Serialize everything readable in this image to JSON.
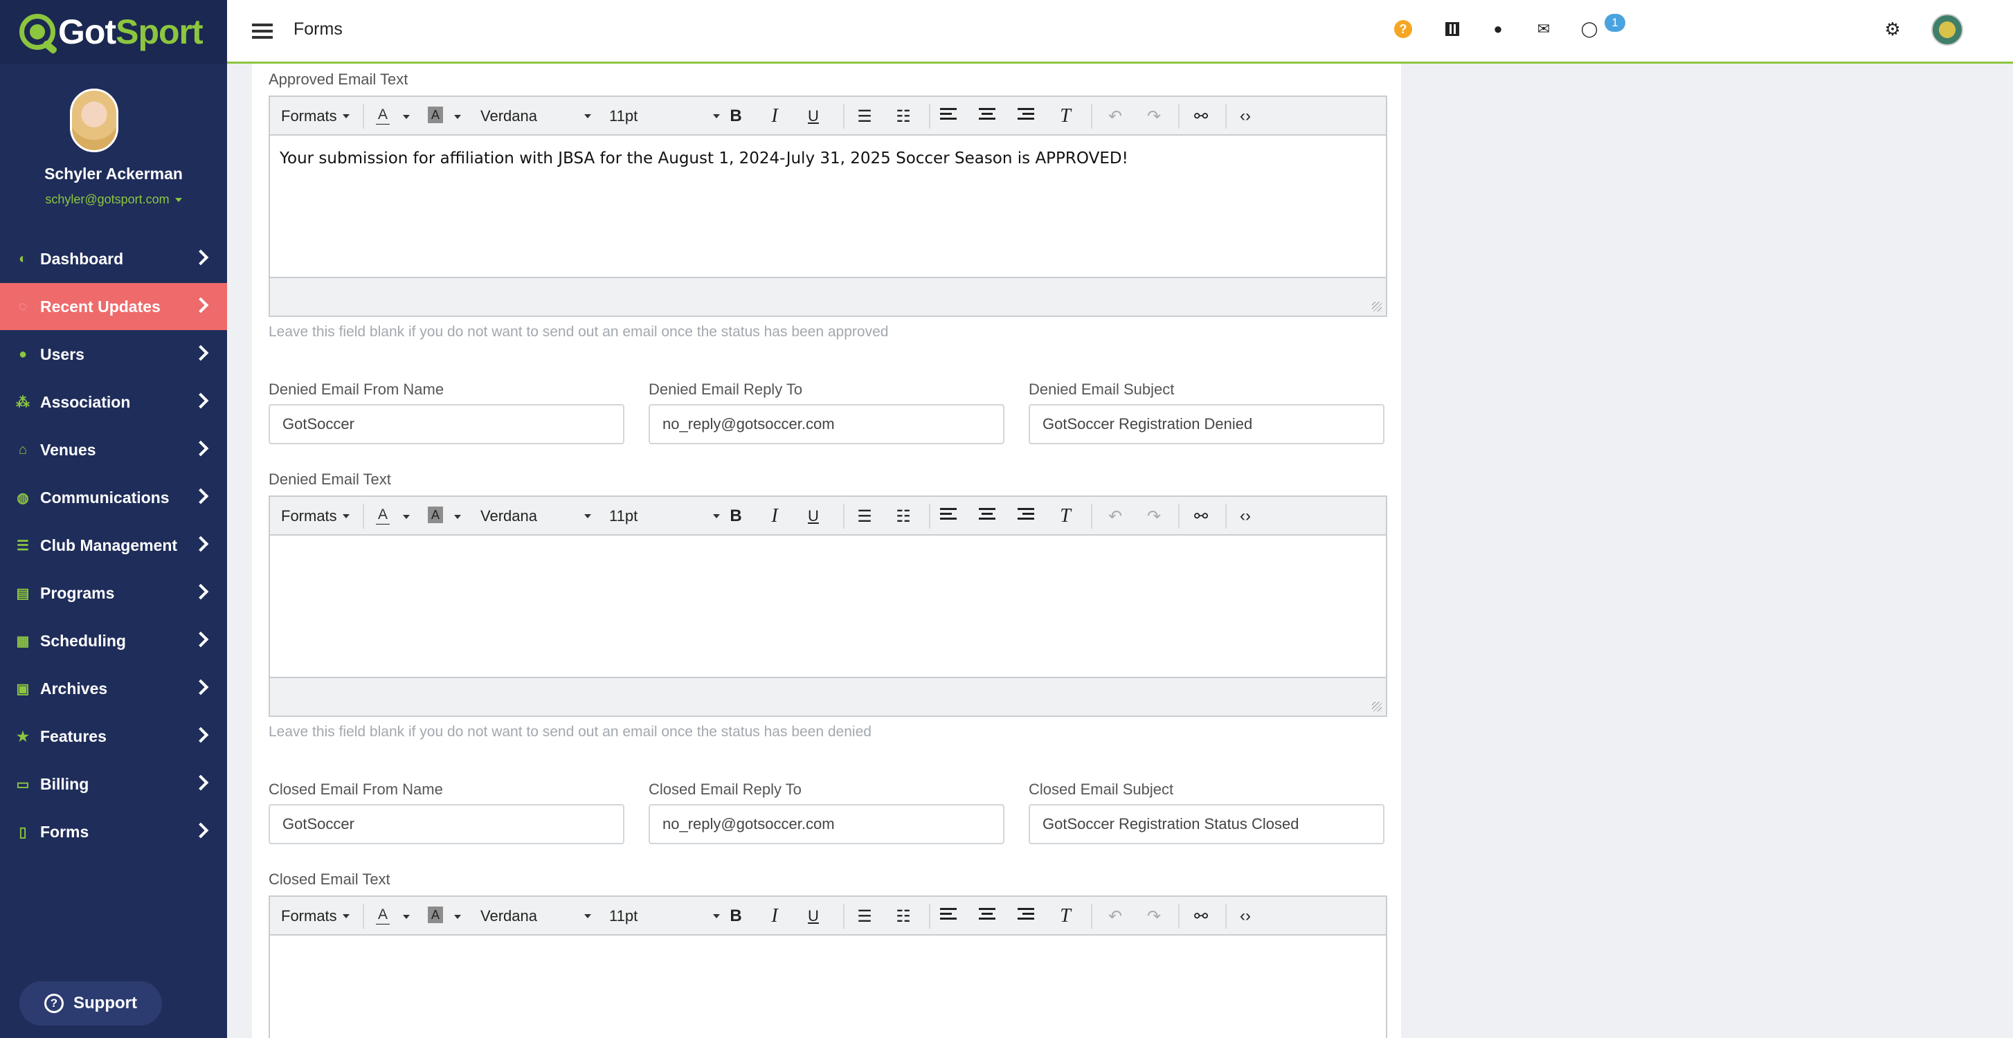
{
  "brand": {
    "logo_got": "Got",
    "logo_sport": "Sport"
  },
  "header": {
    "title": "Forms",
    "chat_badge": "1"
  },
  "icons": {
    "help": "help-icon",
    "qr": "qr-code-icon",
    "user": "user-icon",
    "mail": "envelope-icon",
    "chat": "chat-icon",
    "settings": "gear-icon"
  },
  "colors": {
    "sidebar": "#1f2d5a",
    "accent": "#8cc63f",
    "active": "#ef6a6a",
    "badge": "#4aa3df",
    "help": "#f5a623"
  },
  "profile": {
    "name": "Schyler Ackerman",
    "email": "schyler@gotsport.com"
  },
  "sidebar": {
    "items": [
      {
        "label": "Dashboard",
        "icon": "dashboard-icon"
      },
      {
        "label": "Recent Updates",
        "icon": "updates-icon",
        "active": true
      },
      {
        "label": "Users",
        "icon": "users-icon"
      },
      {
        "label": "Association",
        "icon": "sitemap-icon"
      },
      {
        "label": "Venues",
        "icon": "home-icon"
      },
      {
        "label": "Communications",
        "icon": "comments-icon"
      },
      {
        "label": "Club Management",
        "icon": "list-icon"
      },
      {
        "label": "Programs",
        "icon": "document-icon"
      },
      {
        "label": "Scheduling",
        "icon": "calendar-icon"
      },
      {
        "label": "Archives",
        "icon": "archive-icon"
      },
      {
        "label": "Features",
        "icon": "star-icon"
      },
      {
        "label": "Billing",
        "icon": "credit-card-icon"
      },
      {
        "label": "Forms",
        "icon": "file-icon"
      }
    ],
    "support_label": "Support"
  },
  "toolbar": {
    "formats": "Formats",
    "font_color": "A",
    "bg_color": "A",
    "font_family": "Verdana",
    "font_size": "11pt",
    "bold": "B",
    "italic": "I",
    "underline": "U"
  },
  "approved": {
    "label": "Approved Email Text",
    "text": "Your submission for affiliation with JBSA for the August 1, 2024-July 31, 2025 Soccer Season is APPROVED!",
    "hint": "Leave this field blank if you do not want to send out an email once the status has been approved"
  },
  "denied": {
    "from_label": "Denied Email From Name",
    "from_value": "GotSoccer",
    "reply_label": "Denied Email Reply To",
    "reply_value": "no_reply@gotsoccer.com",
    "subject_label": "Denied Email Subject",
    "subject_value": "GotSoccer Registration Denied",
    "text_label": "Denied Email Text",
    "hint": "Leave this field blank if you do not want to send out an email once the status has been denied"
  },
  "closed": {
    "from_label": "Closed Email From Name",
    "from_value": "GotSoccer",
    "reply_label": "Closed Email Reply To",
    "reply_value": "no_reply@gotsoccer.com",
    "subject_label": "Closed Email Subject",
    "subject_value": "GotSoccer Registration Status Closed",
    "text_label": "Closed Email Text"
  }
}
